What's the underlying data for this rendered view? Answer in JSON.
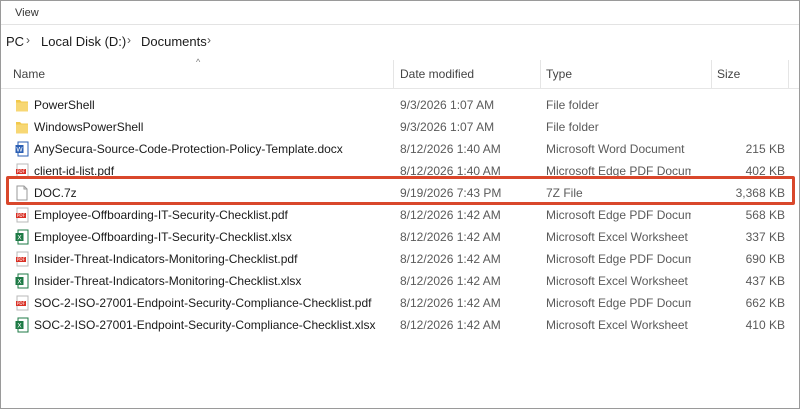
{
  "menubar": {
    "view_label": "View"
  },
  "address": {
    "crumbs": [
      "PC",
      "Local Disk (D:)",
      "Documents"
    ]
  },
  "columns": {
    "name": "Name",
    "date": "Date modified",
    "type": "Type",
    "size": "Size"
  },
  "files": [
    {
      "name": "PowerShell",
      "date": "9/3/2026 1:07 AM",
      "type": "File folder",
      "size": "",
      "icon": "folder-icon"
    },
    {
      "name": "WindowsPowerShell",
      "date": "9/3/2026 1:07 AM",
      "type": "File folder",
      "size": "",
      "icon": "folder-icon"
    },
    {
      "name": "AnySecura-Source-Code-Protection-Policy-Template.docx",
      "date": "8/12/2026 1:40 AM",
      "type": "Microsoft Word Document",
      "size": "215 KB",
      "icon": "word-icon"
    },
    {
      "name": "client-id-list.pdf",
      "date": "8/12/2026 1:40 AM",
      "type": "Microsoft Edge PDF Docum...",
      "size": "402 KB",
      "icon": "pdf-icon"
    },
    {
      "name": "DOC.7z",
      "date": "9/19/2026 7:43 PM",
      "type": "7Z File",
      "size": "3,368 KB",
      "icon": "generic-file-icon"
    },
    {
      "name": "Employee-Offboarding-IT-Security-Checklist.pdf",
      "date": "8/12/2026 1:42 AM",
      "type": "Microsoft Edge PDF Docum...",
      "size": "568 KB",
      "icon": "pdf-icon"
    },
    {
      "name": "Employee-Offboarding-IT-Security-Checklist.xlsx",
      "date": "8/12/2026 1:42 AM",
      "type": "Microsoft Excel Worksheet",
      "size": "337 KB",
      "icon": "excel-icon"
    },
    {
      "name": "Insider-Threat-Indicators-Monitoring-Checklist.pdf",
      "date": "8/12/2026 1:42 AM",
      "type": "Microsoft Edge PDF Docum...",
      "size": "690 KB",
      "icon": "pdf-icon"
    },
    {
      "name": "Insider-Threat-Indicators-Monitoring-Checklist.xlsx",
      "date": "8/12/2026 1:42 AM",
      "type": "Microsoft Excel Worksheet",
      "size": "437 KB",
      "icon": "excel-icon"
    },
    {
      "name": "SOC-2-ISO-27001-Endpoint-Security-Compliance-Checklist.pdf",
      "date": "8/12/2026 1:42 AM",
      "type": "Microsoft Edge PDF Docum...",
      "size": "662 KB",
      "icon": "pdf-icon"
    },
    {
      "name": "SOC-2-ISO-27001-Endpoint-Security-Compliance-Checklist.xlsx",
      "date": "8/12/2026 1:42 AM",
      "type": "Microsoft Excel Worksheet",
      "size": "410 KB",
      "icon": "excel-icon"
    }
  ],
  "colors": {
    "highlight": "#d9472b",
    "folder": "#f2c94c",
    "word": "#2b5fb4",
    "pdf": "#d93025",
    "excel": "#1d7a45"
  }
}
